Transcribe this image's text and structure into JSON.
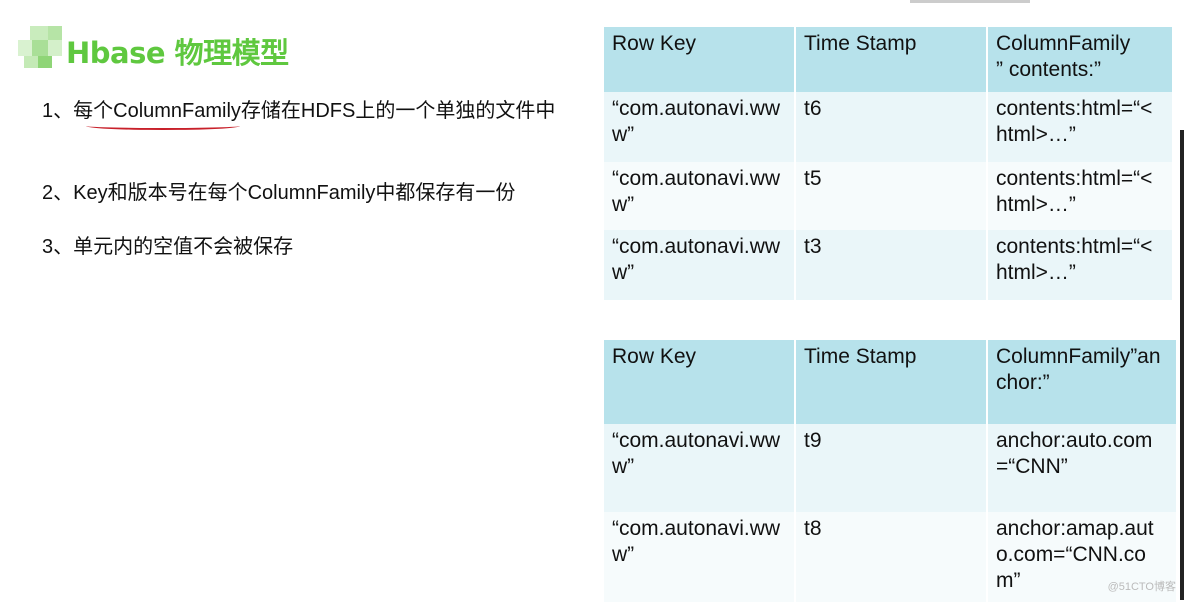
{
  "slide": {
    "title": "Hbase 物理模型",
    "points": [
      "1、每个ColumnFamily存储在HDFS上的一个单独的文件中",
      "2、Key和版本号在每个ColumnFamily中都保存有一份",
      "3、单元内的空值不会被保存"
    ],
    "accent_color": "#5fc83f"
  },
  "tables": [
    {
      "headers": [
        "Row Key",
        "Time Stamp",
        "ColumnFamily\n” contents:”"
      ],
      "rows": [
        [
          "“com.autonavi.www”",
          "t6",
          "contents:html=“<html>…”"
        ],
        [
          "“com.autonavi.www”",
          "t5",
          "contents:html=“<html>…”"
        ],
        [
          "“com.autonavi.www”",
          "t3",
          "contents:html=“<html>…”"
        ]
      ]
    },
    {
      "headers": [
        "Row Key",
        "Time Stamp",
        "ColumnFamily”anchor:”"
      ],
      "rows": [
        [
          "“com.autonavi.www”",
          "t9",
          "anchor:auto.com=“CNN”"
        ],
        [
          "“com.autonavi.www”",
          "t8",
          "anchor:amap.auto.com=“CNN.com”"
        ]
      ]
    }
  ],
  "watermark": "@51CTO博客"
}
